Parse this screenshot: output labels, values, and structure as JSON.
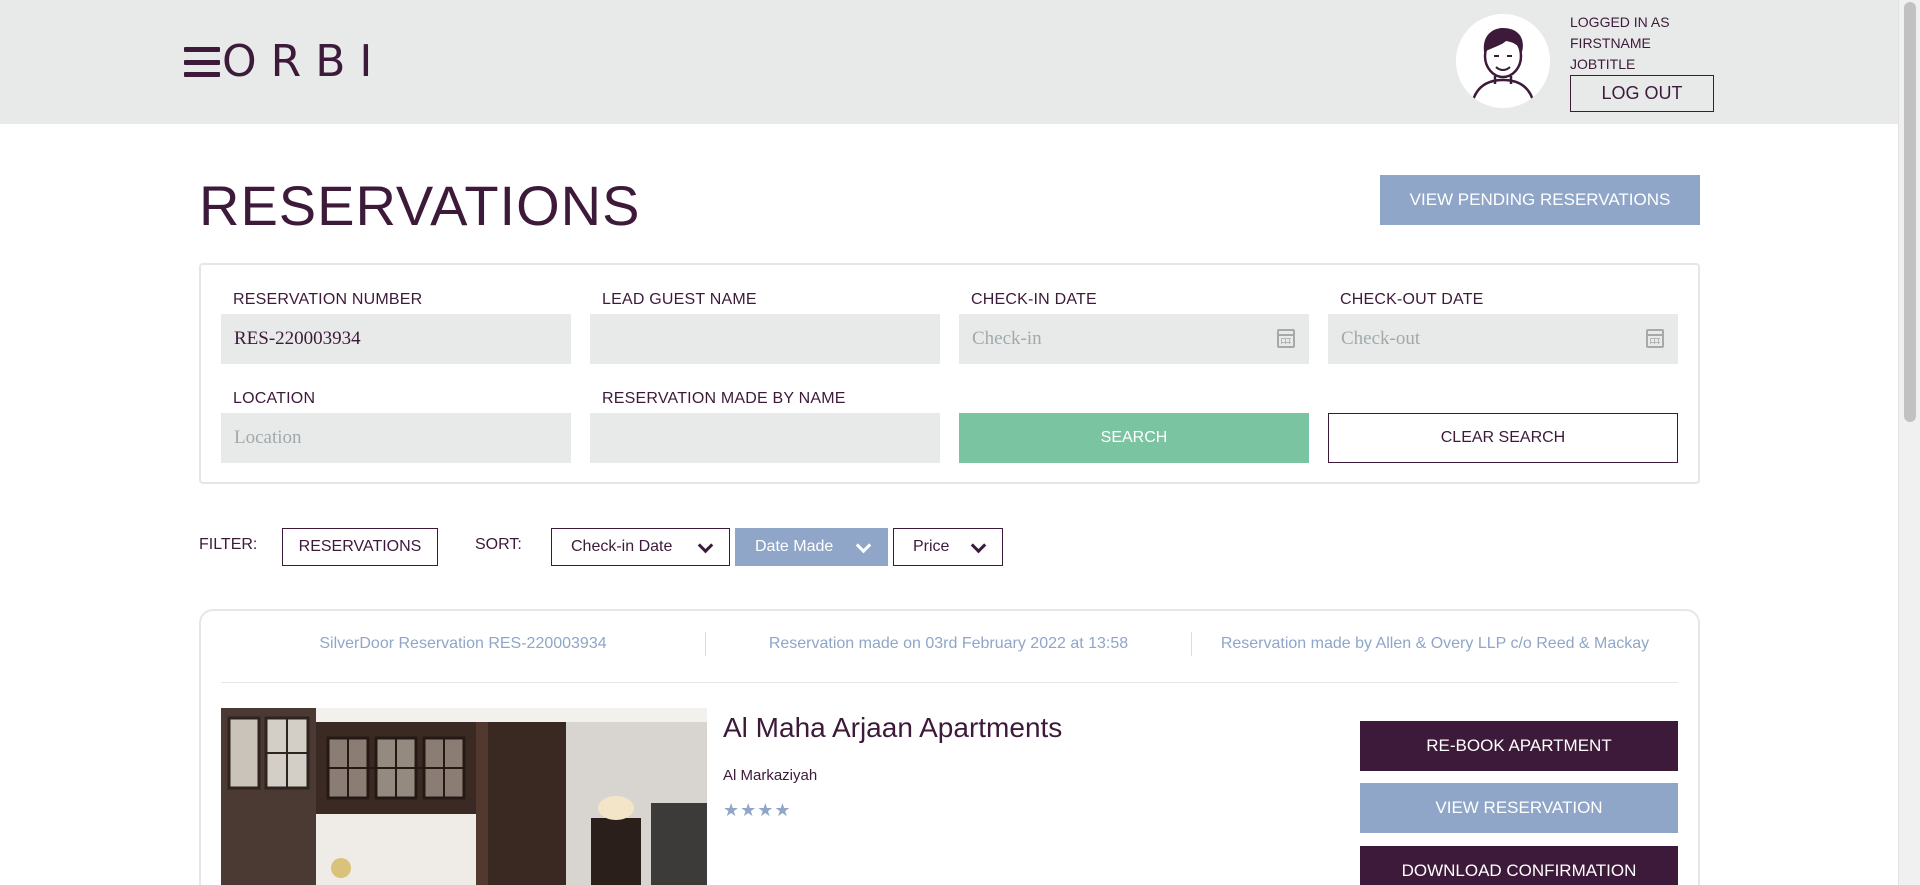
{
  "header": {
    "logo_text": "ORBI",
    "user_label_line1": "LOGGED IN AS",
    "user_label_line2": "FIRSTNAME",
    "user_label_line3": "JOBTITLE",
    "logout_label": "LOG OUT"
  },
  "page": {
    "title": "RESERVATIONS",
    "pending_button_label": "VIEW PENDING RESERVATIONS"
  },
  "search": {
    "reservation_number": {
      "label": "RESERVATION NUMBER",
      "value": "RES-220003934"
    },
    "lead_guest_name": {
      "label": "LEAD GUEST NAME",
      "value": ""
    },
    "check_in": {
      "label": "CHECK-IN DATE",
      "placeholder": "Check-in"
    },
    "check_out": {
      "label": "CHECK-OUT DATE",
      "placeholder": "Check-out"
    },
    "location": {
      "label": "LOCATION",
      "placeholder": "Location"
    },
    "made_by_name": {
      "label": "RESERVATION MADE BY NAME",
      "value": ""
    },
    "search_button_label": "SEARCH",
    "clear_button_label": "CLEAR SEARCH"
  },
  "filter": {
    "filter_label": "FILTER:",
    "filter_button_label": "RESERVATIONS",
    "sort_label": "SORT:",
    "sort_options": [
      {
        "label": "Check-in Date",
        "active": false
      },
      {
        "label": "Date Made",
        "active": true
      },
      {
        "label": "Price",
        "active": false
      }
    ]
  },
  "reservation": {
    "reference_text": "SilverDoor Reservation RES-220003934",
    "made_on_text": "Reservation made on 03rd February 2022 at 13:58",
    "made_by_text": "Reservation made by Allen & Overy LLP c/o Reed & Mackay",
    "hotel_name": "Al Maha Arjaan Apartments",
    "hotel_location": "Al Markaziyah",
    "star_rating": 4,
    "rebook_label": "RE-BOOK APARTMENT",
    "view_label": "VIEW RESERVATION",
    "download_label": "DOWNLOAD CONFIRMATION"
  },
  "colors": {
    "brand": "#3d1a3a",
    "accent_blue": "#8fa6c9",
    "accent_green": "#7bc4a1",
    "header_bg": "#e8eaea"
  },
  "icons": [
    "menu-icon",
    "avatar-icon",
    "calendar-icon",
    "chevron-down-icon",
    "star-icon"
  ]
}
